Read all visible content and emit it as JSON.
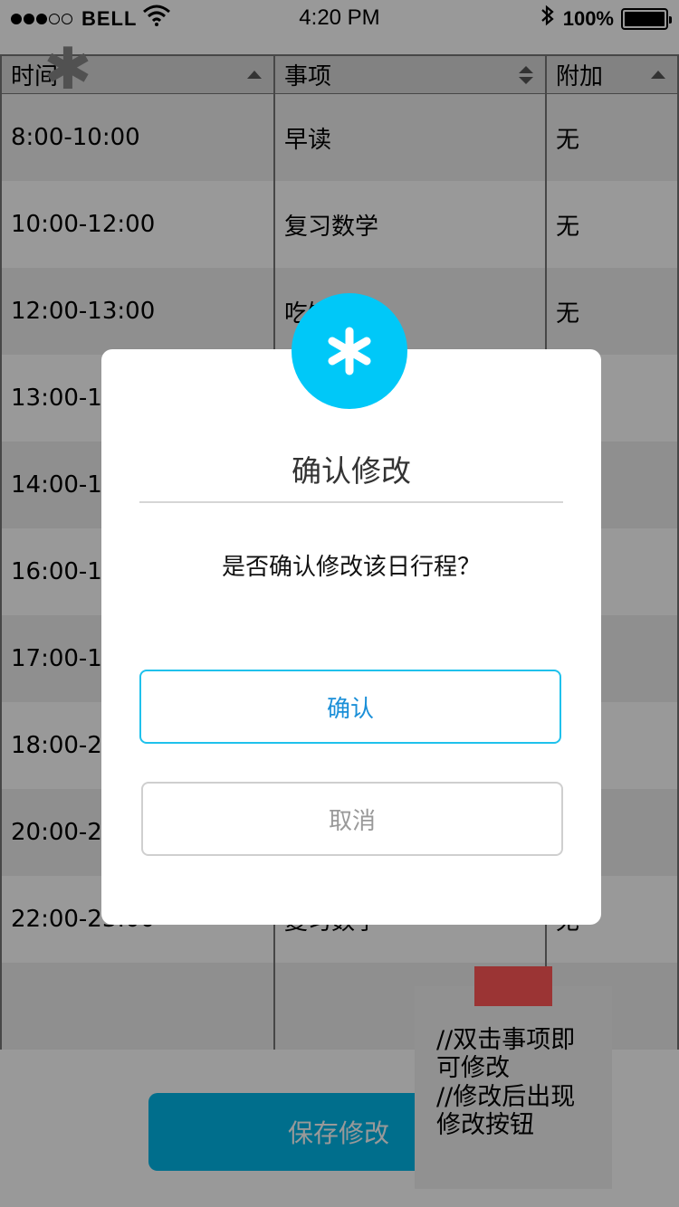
{
  "status_bar": {
    "carrier": "BELL",
    "time": "4:20 PM",
    "battery": "100%",
    "signal_filled": 3,
    "signal_total": 5
  },
  "table": {
    "headers": [
      "时间",
      "事项",
      "附加"
    ],
    "rows": [
      [
        "8:00-10:00",
        "早读",
        "无"
      ],
      [
        "10:00-12:00",
        "复习数学",
        "无"
      ],
      [
        "12:00-13:00",
        "吃饭",
        "无"
      ],
      [
        "13:00-14:00",
        "",
        ""
      ],
      [
        "14:00-16:00",
        "",
        ""
      ],
      [
        "16:00-17:00",
        "",
        ""
      ],
      [
        "17:00-18:00",
        "",
        ""
      ],
      [
        "18:00-20:00",
        "",
        ""
      ],
      [
        "20:00-22:00",
        "",
        ""
      ],
      [
        "22:00-23:00",
        "复习数学",
        "无"
      ],
      [
        "",
        "",
        ""
      ]
    ]
  },
  "save_button": "保存修改",
  "note": {
    "line1": "//双击事项即",
    "line2": "可修改",
    "line3": "//修改后出现",
    "line4": "修改按钮"
  },
  "modal": {
    "title": "确认修改",
    "message": "是否确认修改该日行程？",
    "confirm": "确认",
    "cancel": "取消"
  },
  "colors": {
    "accent": "#00c8f8",
    "note_tab": "#9b3434",
    "confirm_border": "#1fc1ec"
  },
  "icons": {
    "badge": "asterisk-icon",
    "sort_asc": "sort-up-icon",
    "sort_both": "sort-both-icon"
  }
}
